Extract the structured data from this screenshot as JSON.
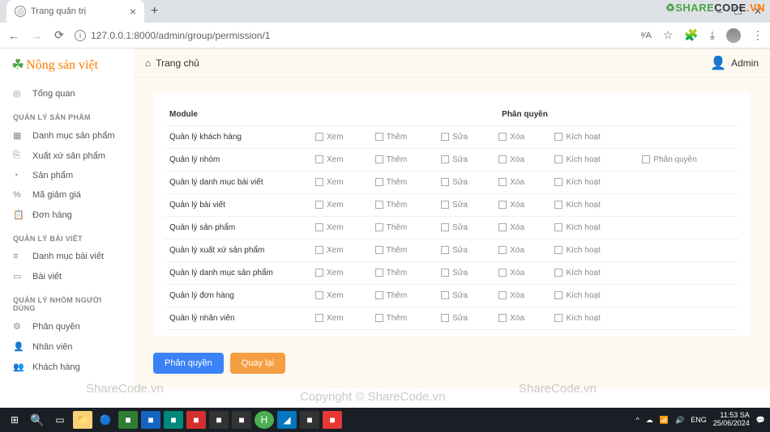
{
  "browser": {
    "tab_title": "Trang quản trị",
    "url": "127.0.0.1:8000/admin/group/permission/1",
    "window_controls": {
      "min": "–",
      "max": "☐",
      "close": "✕"
    }
  },
  "watermark": {
    "logo_share": "SHARE",
    "logo_code": "CODE",
    "logo_ext": ".VN",
    "wm1": "ShareCode.vn",
    "wm2": "Copyright © ShareCode.vn",
    "wm3": "ShareCode.vn"
  },
  "logo": {
    "text": "Nông sản việt"
  },
  "sidebar": {
    "overview": "Tổng quan",
    "sec_product": "QUẢN LÝ SẢN PHẨM",
    "items_product": [
      "Danh mục sản phẩm",
      "Xuất xứ sản phẩm",
      "Sản phẩm",
      "Mã giảm giá",
      "Đơn hàng"
    ],
    "sec_post": "QUẢN LÝ BÀI VIẾT",
    "items_post": [
      "Danh mục bài viết",
      "Bài viết"
    ],
    "sec_user": "QUẢN LÝ NHÓM NGƯỜI DÙNG",
    "items_user": [
      "Phân quyền",
      "Nhân viên",
      "Khách hàng"
    ]
  },
  "topbar": {
    "home": "Trang chủ",
    "user": "Admin"
  },
  "table": {
    "col_module": "Module",
    "col_perm": "Phân quyền",
    "perms": {
      "view": "Xem",
      "add": "Thêm",
      "edit": "Sửa",
      "delete": "Xóa",
      "activate": "Kích hoạt",
      "perm": "Phân quyền"
    },
    "rows": [
      {
        "module": "Quản lý khách hàng",
        "has_perm": false
      },
      {
        "module": "Quản lý nhóm",
        "has_perm": true
      },
      {
        "module": "Quản lý danh mục bài viết",
        "has_perm": false
      },
      {
        "module": "Quản lý bài viết",
        "has_perm": false
      },
      {
        "module": "Quản lý sản phẩm",
        "has_perm": false
      },
      {
        "module": "Quản lý xuất xứ sản phẩm",
        "has_perm": false
      },
      {
        "module": "Quản lý danh mục sản phẩm",
        "has_perm": false
      },
      {
        "module": "Quản lý đơn hàng",
        "has_perm": false
      },
      {
        "module": "Quản lý nhân viên",
        "has_perm": false
      }
    ]
  },
  "buttons": {
    "submit": "Phân quyền",
    "back": "Quay lại"
  },
  "taskbar": {
    "lang": "ENG",
    "time": "11:53 SA",
    "date": "25/06/2024"
  }
}
